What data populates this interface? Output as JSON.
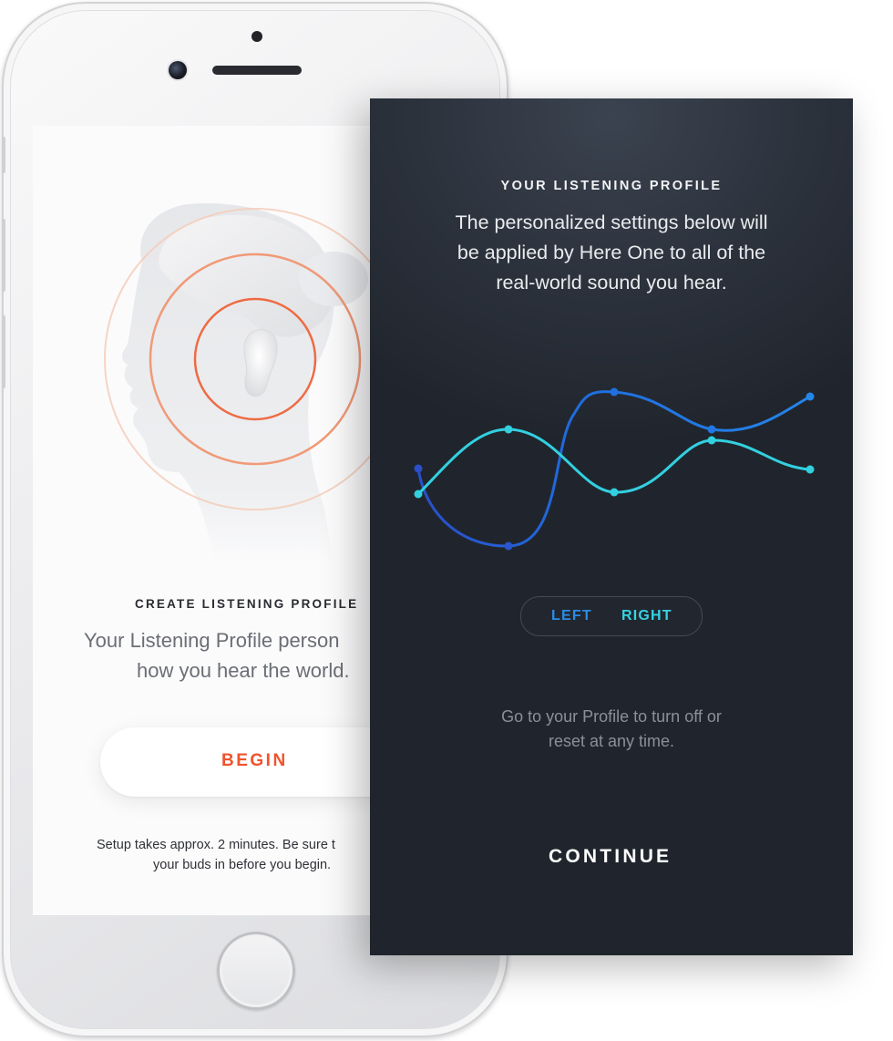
{
  "white_screen": {
    "title": "CREATE LISTENING PROFILE",
    "body_line1": "Your Listening Profile person",
    "body_line2": "how you hear the world.",
    "begin_label": "BEGIN",
    "note_line1": "Setup takes approx. 2 minutes. Be sure t",
    "note_line2": "your buds in before you begin.",
    "colors": {
      "accent": "#f0532d",
      "ring": "#ef7a52"
    }
  },
  "dark_screen": {
    "title": "YOUR LISTENING PROFILE",
    "body_line1": "The personalized settings below will",
    "body_line2": "be applied by Here One to all of the",
    "body_line3": "real-world sound you hear.",
    "toggle": {
      "left_label": "LEFT",
      "right_label": "RIGHT",
      "left_color": "#2b8ce6",
      "right_color": "#36d2e3"
    },
    "note_line1": "Go to your Profile to turn off or",
    "note_line2": "reset at any time.",
    "continue_label": "CONTINUE",
    "colors": {
      "background": "#272c35",
      "left_curve": "#1f6fe0",
      "right_curve": "#32d0e0"
    }
  }
}
